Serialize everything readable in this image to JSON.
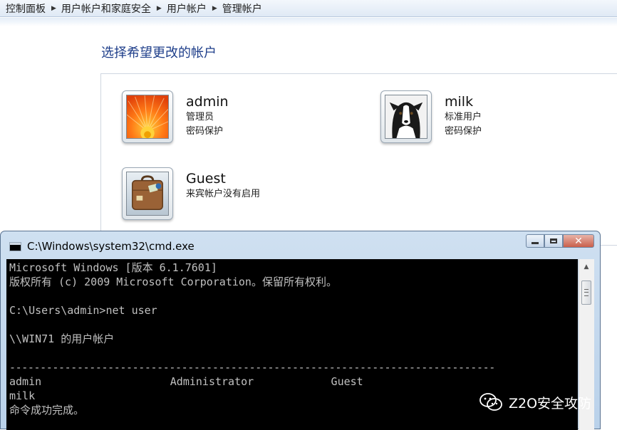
{
  "breadcrumb": {
    "items": [
      "控制面板",
      "用户帐户和家庭安全",
      "用户帐户",
      "管理帐户"
    ]
  },
  "page_title": "选择希望更改的帐户",
  "accounts": [
    {
      "name": "admin",
      "type": "管理员",
      "detail": "密码保护",
      "picture_icon": "flower-icon"
    },
    {
      "name": "milk",
      "type": "标准用户",
      "detail": "密码保护",
      "picture_icon": "dog-icon"
    },
    {
      "name": "Guest",
      "type": "来宾帐户没有启用",
      "picture_icon": "suitcase-icon"
    }
  ],
  "cmd": {
    "title": "C:\\Windows\\system32\\cmd.exe",
    "lines": [
      "Microsoft Windows [版本 6.1.7601]",
      "版权所有 (c) 2009 Microsoft Corporation。保留所有权利。",
      "",
      "C:\\Users\\admin>net user",
      "",
      "\\\\WIN71 的用户帐户",
      "",
      "-------------------------------------------------------------------------------",
      "admin                    Administrator            Guest",
      "milk",
      "命令成功完成。"
    ]
  },
  "watermark": {
    "text": "Z2O安全攻防",
    "icon": "wechat-icon"
  },
  "colors": {
    "title_blue": "#1e3e8a",
    "console_bg": "#000000",
    "console_fg": "#c0c0c0",
    "close_red": "#c9604b"
  }
}
